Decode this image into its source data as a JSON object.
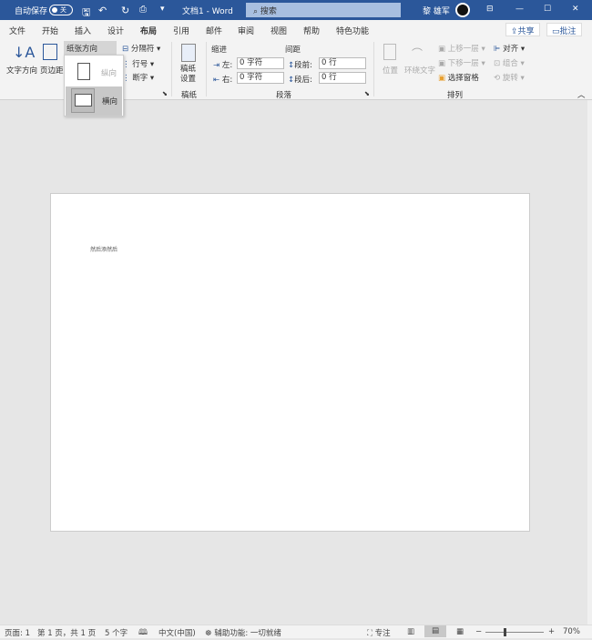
{
  "titlebar": {
    "autosave": "自动保存",
    "autosave_state": "关",
    "title": "文档1 - Word",
    "search_placeholder": "搜索",
    "user": "黎 雄军",
    "color": "#2b579a"
  },
  "menu": {
    "tabs": [
      "文件",
      "开始",
      "插入",
      "设计",
      "布局",
      "引用",
      "邮件",
      "审阅",
      "视图",
      "帮助",
      "特色功能"
    ],
    "active": "布局",
    "share": "共享",
    "comments": "批注"
  },
  "ribbon": {
    "text_direction": "文字方向",
    "margins": "页边距",
    "orientation": "纸张方向",
    "breaks": "分隔符",
    "line_numbers": "行号",
    "hyphenation": "断字",
    "draft": "稿纸\n设置",
    "draft_group": "稿纸",
    "indent": "缩进",
    "spacing": "间距",
    "left": "左:",
    "right": "右:",
    "before": "段前:",
    "after": "段后:",
    "left_val": "0 字符",
    "right_val": "0 字符",
    "before_val": "0 行",
    "after_val": "0 行",
    "paragraph_group": "段落",
    "position": "位置",
    "wrap_text": "环绕文字",
    "bring_forward": "上移一层",
    "send_backward": "下移一层",
    "selection_pane": "选择窗格",
    "align": "对齐",
    "group": "组合",
    "rotate": "旋转",
    "arrange_group": "排列"
  },
  "orientation_menu": {
    "portrait": "纵向",
    "landscape": "横向",
    "selected": "横向"
  },
  "document": {
    "text": "然后添然后"
  },
  "status": {
    "page": "页面: 1",
    "pages": "第 1 页，共 1 页",
    "words": "5 个字",
    "language": "中文(中国)",
    "accessibility": "辅助功能: 一切就绪",
    "focus": "专注",
    "zoom": "70%",
    "zoom_value": 70
  }
}
